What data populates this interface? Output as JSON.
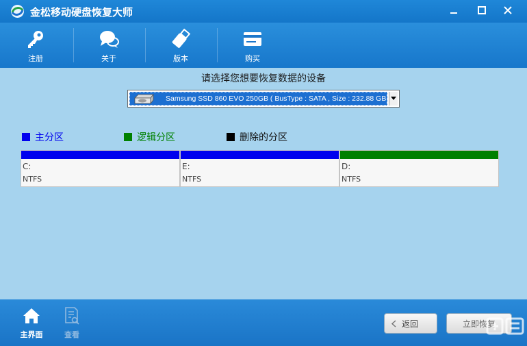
{
  "window": {
    "title": "金松移动硬盘恢复大师",
    "controls": [
      "minimize-icon",
      "maximize-icon",
      "close-icon"
    ]
  },
  "toolbar": {
    "items": [
      {
        "label": "注册",
        "icon": "key-icon"
      },
      {
        "label": "关于",
        "icon": "chat-bubbles-icon"
      },
      {
        "label": "版本",
        "icon": "usb-stick-icon"
      },
      {
        "label": "购买",
        "icon": "credit-card-icon"
      }
    ]
  },
  "main": {
    "prompt": "请选择您想要恢复数据的设备",
    "device_select": {
      "value": "Samsung SSD 860 EVO 250GB ( BusType :  SATA ,    Size :  232.88 GB )",
      "icon": "hard-drive-icon"
    },
    "legend": [
      {
        "label": "主分区",
        "color": "#0000ee",
        "text_color": "#0000ee"
      },
      {
        "label": "逻辑分区",
        "color": "#008000",
        "text_color": "#008000"
      },
      {
        "label": "删除的分区",
        "color": "#000000",
        "text_color": "#111111"
      }
    ],
    "partitions": [
      {
        "letter": "C:",
        "fs": "NTFS",
        "color": "#0000ee"
      },
      {
        "letter": "E:",
        "fs": "NTFS",
        "color": "#0000ee"
      },
      {
        "letter": "D:",
        "fs": "NTFS",
        "color": "#008000"
      }
    ]
  },
  "footer": {
    "nav": [
      {
        "label": "主界面",
        "icon": "home-icon",
        "active": true
      },
      {
        "label": "查看",
        "icon": "document-search-icon",
        "active": false
      }
    ],
    "back_label": "返回",
    "recover_label": "立即恢复"
  }
}
